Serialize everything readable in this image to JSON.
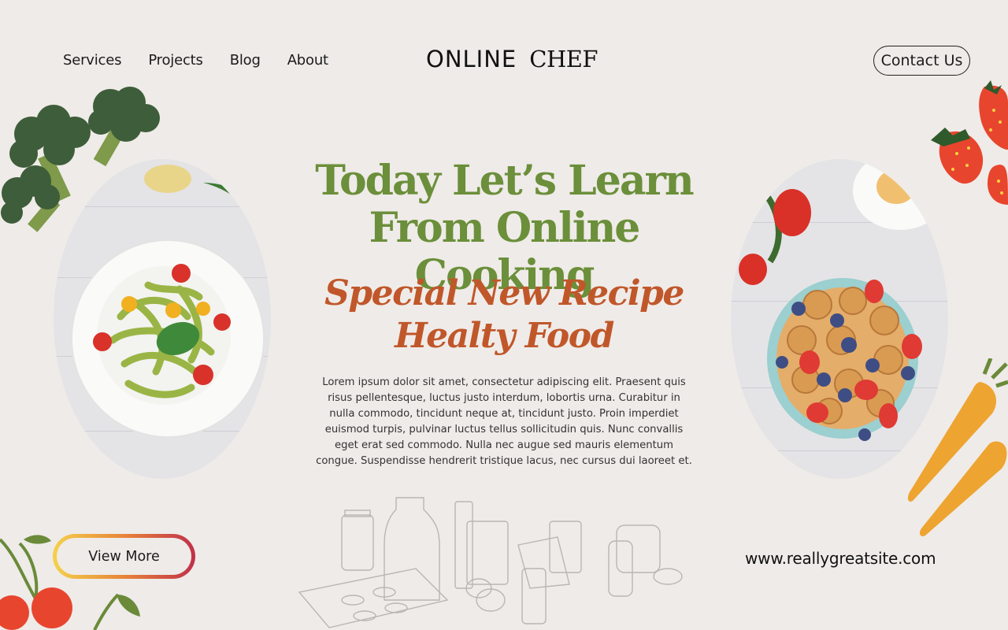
{
  "nav": {
    "items": [
      "Services",
      "Projects",
      "Blog",
      "About"
    ]
  },
  "logo": {
    "part1": "ONLINE",
    "part2": "CHEF"
  },
  "contact_label": "Contact Us",
  "hero": {
    "headline_line1": "Today Let’s Learn",
    "headline_line2": "From Online Cooking",
    "sub_line1": "Special New Recipe",
    "sub_line2": "Healty Food",
    "paragraph": "Lorem ipsum dolor sit amet, consectetur adipiscing elit. Praesent quis risus pellentesque, luctus justo interdum, lobortis urna. Curabitur in nulla commodo, tincidunt neque at, tincidunt justo. Proin imperdiet euismod turpis, pulvinar luctus tellus sollicitudin quis. Nunc convallis eget erat sed commodo. Nulla nec augue sed mauris elementum congue. Suspendisse hendrerit tristique lacus, nec cursus dui laoreet et."
  },
  "view_more_label": "View More",
  "website": "www.reallygreatsite.com",
  "colors": {
    "background": "#efebe8",
    "headline": "#6b8f3a",
    "subheadline": "#c0572a",
    "broccoli": "#3e5d3a",
    "strawberry": "#e8452e",
    "carrot": "#eea431"
  },
  "images": {
    "left": "pesto-pasta-plate",
    "right": "pancake-berry-bowl"
  }
}
